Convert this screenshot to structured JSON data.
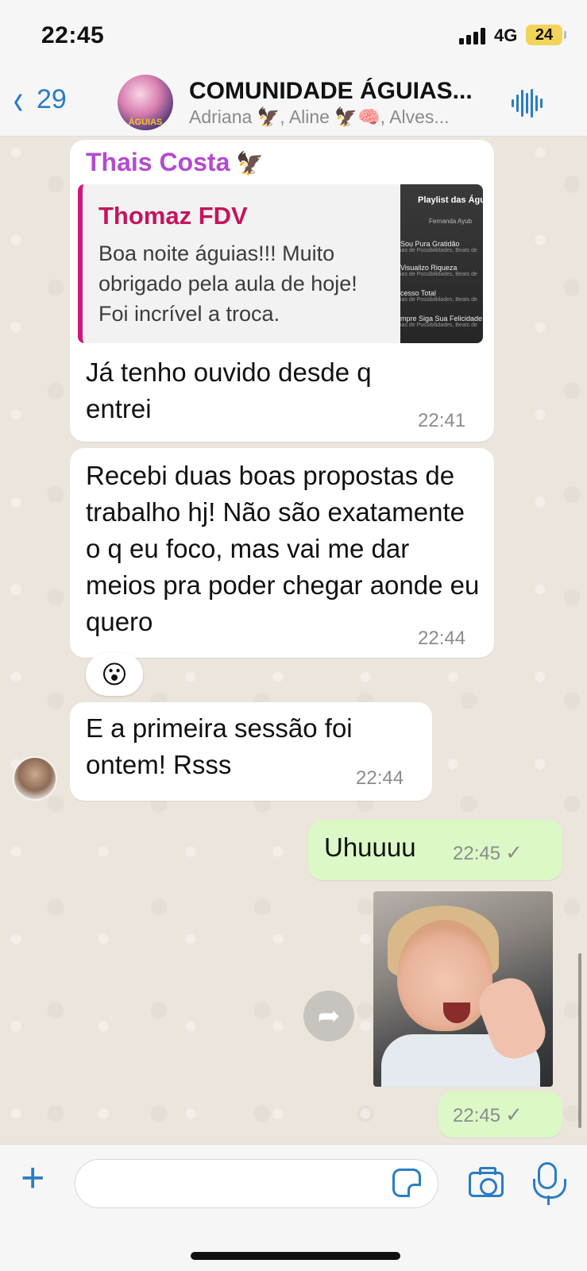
{
  "status_bar": {
    "time": "22:45",
    "network": "4G",
    "battery": "24"
  },
  "header": {
    "back_count": "29",
    "group_title": "COMUNIDADE ÁGUIAS...",
    "members": "Adriana 🦅, Aline 🦅🧠, Alves...",
    "avatar_label": "ÁGUIAS",
    "icons": {
      "back": "chevron-left-icon",
      "voice": "voice-waveform-icon"
    }
  },
  "messages": [
    {
      "sender": "Thais Costa",
      "sender_emoji": "🦅",
      "quote": {
        "author": "Thomaz FDV",
        "text": "Boa noite águias!!! Muito obrigado pela aula de hoje! Foi incrível a troca.",
        "thumbnail": {
          "title": "Playlist das Águ",
          "subtitle": "Fernanda Ayub",
          "tracks": [
            {
              "title": "Sou Pura Gratidão",
              "sub": "ias de Possibilidades, Beats de"
            },
            {
              "title": "Visualizo Riqueza",
              "sub": "ias de Possibilidades, Beats de"
            },
            {
              "title": "cesso Total",
              "sub": "ias de Possibilidades, Beats de"
            },
            {
              "title": "mpre Siga Sua Felicidade",
              "sub": "ias de Possibilidades, Beats de"
            }
          ]
        }
      },
      "text": "Já tenho ouvido desde q entrei",
      "time": "22:41"
    },
    {
      "text": "Recebi duas boas propostas de trabalho hj! Não são exatamente o q eu foco, mas vai me dar meios  pra poder chegar aonde eu quero",
      "time": "22:44",
      "reaction": "😮"
    },
    {
      "text": "E a primeira sessão foi ontem! Rsss",
      "time": "22:44"
    },
    {
      "outgoing": true,
      "text": "Uhuuuu",
      "time": "22:45",
      "status": "✓"
    },
    {
      "outgoing": true,
      "type": "gif",
      "time": "22:45",
      "status": "✓"
    }
  ],
  "input_bar": {
    "placeholder": "",
    "icons": {
      "attach": "plus-icon",
      "sticker": "sticker-icon",
      "camera": "camera-icon",
      "mic": "microphone-icon"
    }
  },
  "colors": {
    "accent": "#2a7dc4",
    "sender_name": "#b44bd0",
    "quote_author": "#c4145f",
    "outgoing_bubble": "#dbf8c6",
    "chat_background": "#ece5dc"
  }
}
